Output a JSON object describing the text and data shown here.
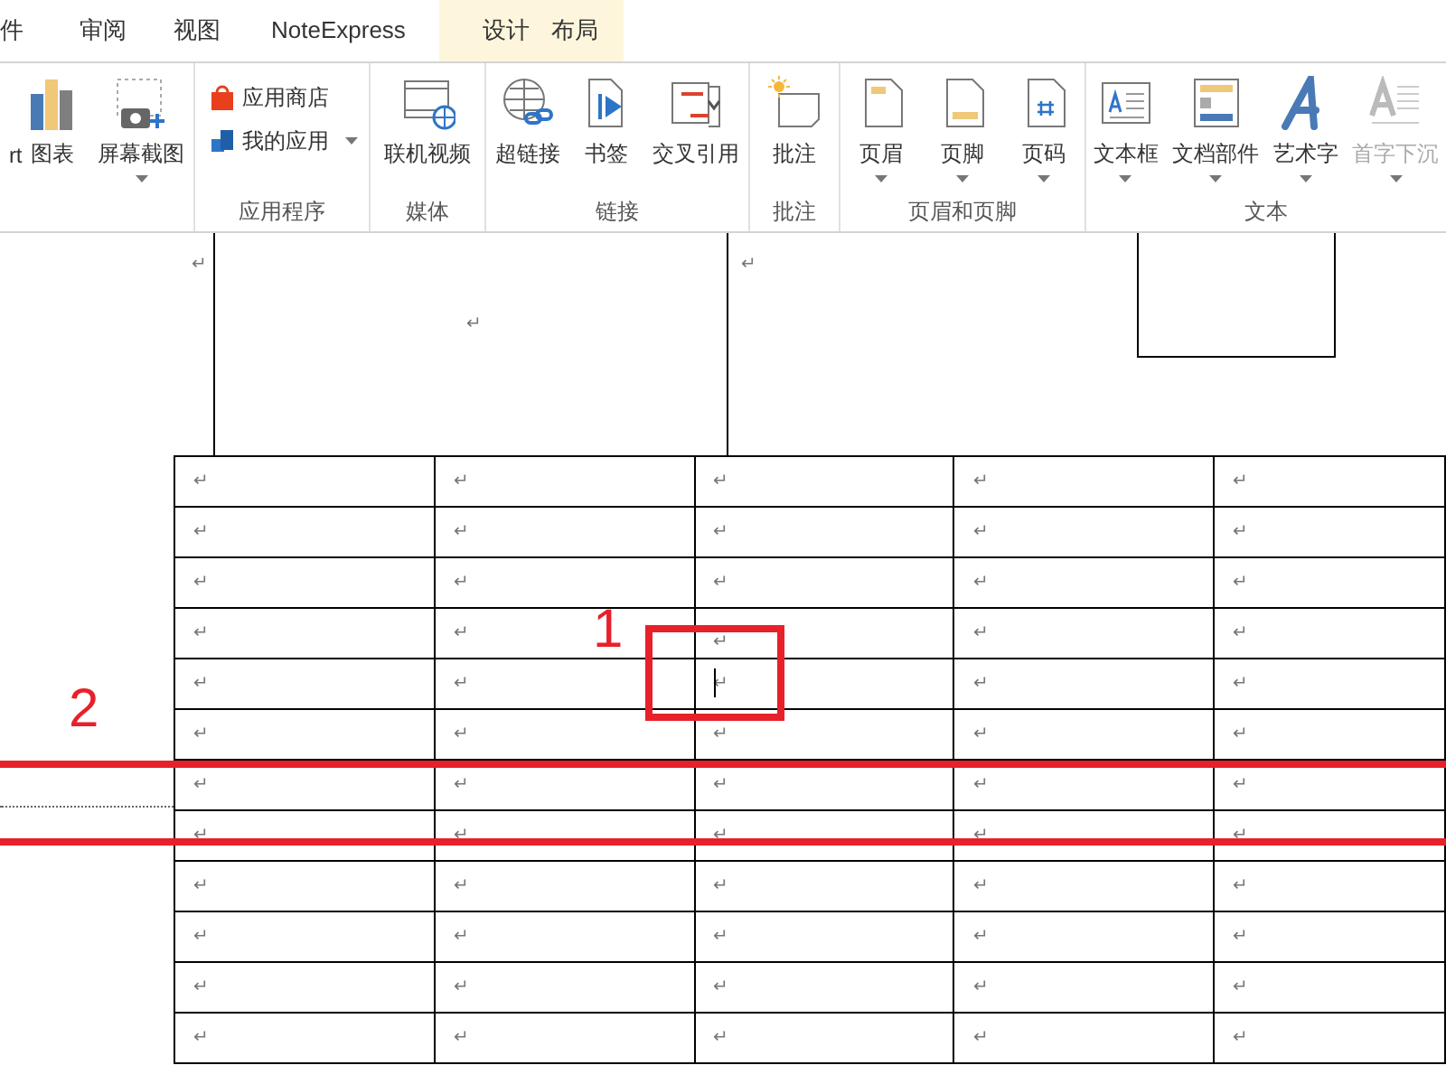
{
  "tabs": [
    {
      "label": "件",
      "kind": "normal"
    },
    {
      "label": "审阅",
      "kind": "normal"
    },
    {
      "label": "视图",
      "kind": "normal"
    },
    {
      "label": "NoteExpress",
      "kind": "normal"
    },
    {
      "label": "设计",
      "kind": "contextual"
    },
    {
      "label": "布局",
      "kind": "contextual"
    }
  ],
  "ribbon_groups": [
    {
      "items": [
        {
          "label": "rt",
          "kind": "cut",
          "dropdown": false,
          "disabled": false
        },
        {
          "label": "图表",
          "kind": "big",
          "dropdown": false,
          "disabled": false
        },
        {
          "label": "屏幕截图",
          "kind": "big",
          "dropdown": true,
          "disabled": false
        }
      ]
    },
    {
      "label": "应用程序",
      "items": [
        {
          "label": "应用商店",
          "kind": "small",
          "dropdown": false,
          "disabled": false
        },
        {
          "label": "我的应用",
          "kind": "small",
          "dropdown": true,
          "disabled": false
        }
      ]
    },
    {
      "label": "媒体",
      "items": [
        {
          "label": "联机视频",
          "kind": "big",
          "dropdown": false,
          "disabled": false
        }
      ]
    },
    {
      "label": "链接",
      "items": [
        {
          "label": "超链接",
          "kind": "big",
          "dropdown": false,
          "disabled": false
        },
        {
          "label": "书签",
          "kind": "big",
          "dropdown": false,
          "disabled": false
        },
        {
          "label": "交叉引用",
          "kind": "big",
          "dropdown": false,
          "disabled": false
        }
      ]
    },
    {
      "label": "批注",
      "items": [
        {
          "label": "批注",
          "kind": "big",
          "dropdown": false,
          "disabled": false
        }
      ]
    },
    {
      "label": "页眉和页脚",
      "items": [
        {
          "label": "页眉",
          "kind": "big",
          "dropdown": true,
          "disabled": false
        },
        {
          "label": "页脚",
          "kind": "big",
          "dropdown": true,
          "disabled": false
        },
        {
          "label": "页码",
          "kind": "big",
          "dropdown": true,
          "disabled": false
        }
      ]
    },
    {
      "label": "文本",
      "items": [
        {
          "label": "文本框",
          "kind": "big",
          "dropdown": true,
          "disabled": false
        },
        {
          "label": "文档部件",
          "kind": "big",
          "dropdown": true,
          "disabled": false
        },
        {
          "label": "艺术字",
          "kind": "big",
          "dropdown": true,
          "disabled": false
        },
        {
          "label": "首字下沉",
          "kind": "big",
          "dropdown": true,
          "disabled": true
        }
      ]
    }
  ],
  "document": {
    "upper_marks": [
      "↵",
      "↵",
      "↵"
    ],
    "table_rows": [
      [
        "↵",
        "↵",
        "↵",
        "↵",
        "↵"
      ],
      [
        "↵",
        "↵",
        "↵",
        "↵",
        "↵"
      ],
      [
        "↵",
        "↵",
        "↵",
        "↵",
        "↵"
      ],
      [
        "↵",
        "↵",
        "↵",
        "↵",
        "↵"
      ],
      [
        "↵",
        "↵",
        "↵",
        "↵",
        "↵"
      ],
      [
        "↵",
        "↵",
        "↵",
        "↵",
        "↵"
      ],
      [
        "↵",
        "↵",
        "↵",
        "↵",
        "↵"
      ],
      [
        "↵",
        "↵",
        "↵",
        "↵",
        "↵"
      ],
      [
        "↵",
        "↵",
        "↵",
        "↵",
        "↵"
      ],
      [
        "↵",
        "↵",
        "↵",
        "↵",
        "↵"
      ],
      [
        "↵",
        "↵",
        "↵",
        "↵",
        "↵"
      ],
      [
        "↵",
        "↵",
        "↵",
        "↵",
        "↵"
      ]
    ]
  },
  "annotations": [
    {
      "label": "1"
    },
    {
      "label": "2"
    }
  ]
}
